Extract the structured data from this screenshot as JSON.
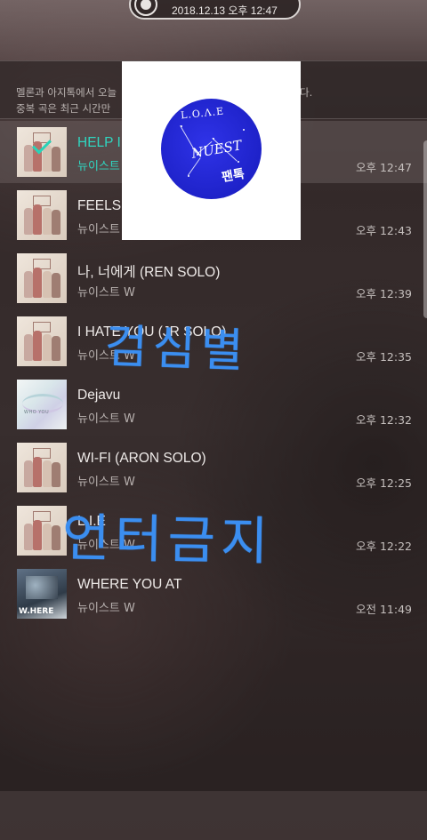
{
  "status_pill": {
    "timestamp": "2018.12.13 오후 12:47",
    "icon": "record-icon"
  },
  "notice": {
    "line1": "멜론과 아지톡에서 오늘",
    "line1_suffix": "다.",
    "line2": "중복 곡은 최근 시간만"
  },
  "songs": [
    {
      "title": "HELP I",
      "artist": "뉴이스트",
      "time": "오후 12:47",
      "selected": true,
      "cover": "group-photo"
    },
    {
      "title": "FEELS",
      "artist": "뉴이스트 W",
      "time": "오후 12:43",
      "selected": false,
      "cover": "group-photo"
    },
    {
      "title": "나, 너에게 (REN SOLO)",
      "artist": "뉴이스트 W",
      "time": "오후 12:39",
      "selected": false,
      "cover": "group-photo"
    },
    {
      "title": "I HATE YOU (JR SOLO)",
      "artist": "뉴이스트 W",
      "time": "오후 12:35",
      "selected": false,
      "cover": "group-photo"
    },
    {
      "title": "Dejavu",
      "artist": "뉴이스트 W",
      "time": "오후 12:32",
      "selected": false,
      "cover": "who-you"
    },
    {
      "title": "WI-FI (ARON SOLO)",
      "artist": "뉴이스트 W",
      "time": "오후 12:25",
      "selected": false,
      "cover": "group-photo"
    },
    {
      "title": "L.I.E",
      "artist": "뉴이스트 W",
      "time": "오후 12:22",
      "selected": false,
      "cover": "group-photo"
    },
    {
      "title": "WHERE YOU AT",
      "artist": "뉴이스트 W",
      "time": "오전 11:49",
      "selected": false,
      "cover": "w-here"
    }
  ],
  "covers": {
    "dejavu_small_text": "WHO   YOU",
    "where_text": "W.HERE"
  },
  "album_overlay": {
    "line1": "L.O.Λ.E",
    "line2": "NUEST",
    "line3": "팬톡"
  },
  "watermark": {
    "line1": "검심별",
    "line2": "언터금지"
  },
  "colors": {
    "accent": "#2fd6c0",
    "watermark": "#3b8ef0",
    "disc": "#2326d6"
  }
}
